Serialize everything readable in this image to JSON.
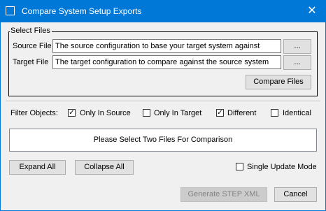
{
  "window": {
    "title": "Compare System Setup Exports",
    "close_glyph": "✕"
  },
  "files": {
    "group_label": "Select Files",
    "source_label": "Source File",
    "source_value": "The source configuration to base your target system against",
    "target_label": "Target File",
    "target_value": "The target configuration to compare against the source system",
    "browse_label": "...",
    "compare_label": "Compare Files"
  },
  "filters": {
    "label": "Filter Objects:",
    "options": [
      {
        "label": "Only In Source",
        "checked": true
      },
      {
        "label": "Only In Target",
        "checked": false
      },
      {
        "label": "Different",
        "checked": true
      },
      {
        "label": "Identical",
        "checked": false
      }
    ]
  },
  "status": {
    "message": "Please Select Two Files For Comparison"
  },
  "actions": {
    "expand_label": "Expand All",
    "collapse_label": "Collapse All",
    "single_update_label": "Single Update Mode",
    "single_update_checked": false,
    "generate_label": "Generate STEP XML",
    "cancel_label": "Cancel"
  },
  "colors": {
    "titlebar": "#0078d7",
    "window_bg": "#f0f0f0"
  }
}
